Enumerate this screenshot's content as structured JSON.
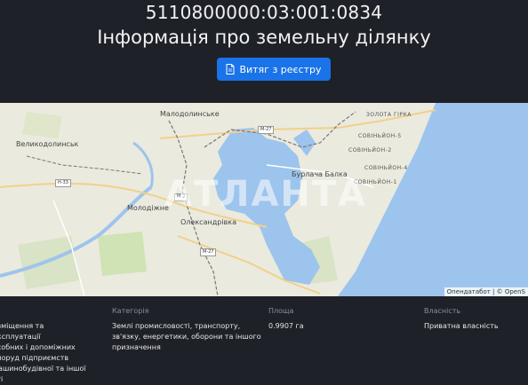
{
  "header": {
    "cadastral_number": "5110800000:03:001:0834",
    "title": "Інформація про земельну ділянку",
    "extract_button_label": "Витяг з реєстру"
  },
  "map": {
    "watermark": "АТЛАНТА",
    "attribution": "Опендатабот | © OpenS",
    "places": {
      "malodolynske": "Малодолинське",
      "velykodolynske": "Великодолинськ",
      "molodizhne": "Молодіжне",
      "oleksandrivka": "Олександрівка",
      "burlacha_balka": "Бурлача Балка",
      "zolota_girka": "ЗОЛОТА ГІРКА",
      "sovinyon_5": "СОВІНЬЙОН-5",
      "sovinyon_2": "СОВІНЬЙОН-2",
      "sovinyon_4": "СОВІНЬЙОН-4",
      "sovinyon_1": "СОВІНЬЙОН-1"
    },
    "roads": {
      "m27_top": "M-27",
      "m27_bottom": "M-27",
      "h33": "H-33",
      "m2": "M-2"
    },
    "colors": {
      "water": "#9dc4ec",
      "land": "#eaeadf",
      "green": "#cfe3b5"
    }
  },
  "info": {
    "purpose": {
      "label": "я",
      "lines": [
        "озміщення та експлуатації",
        "особних і допоміжних",
        "споруд підприємств",
        "машинобудівної та іншої",
        "сті"
      ]
    },
    "category": {
      "label": "Категорія",
      "lines": [
        "Землі промисловості, транспорту,",
        "зв'язку, енергетики, оборони та іншого",
        "призначення"
      ]
    },
    "area": {
      "label": "Площа",
      "value": "0.9907 га"
    },
    "ownership": {
      "label": "Власність",
      "value": "Приватна власність"
    }
  }
}
